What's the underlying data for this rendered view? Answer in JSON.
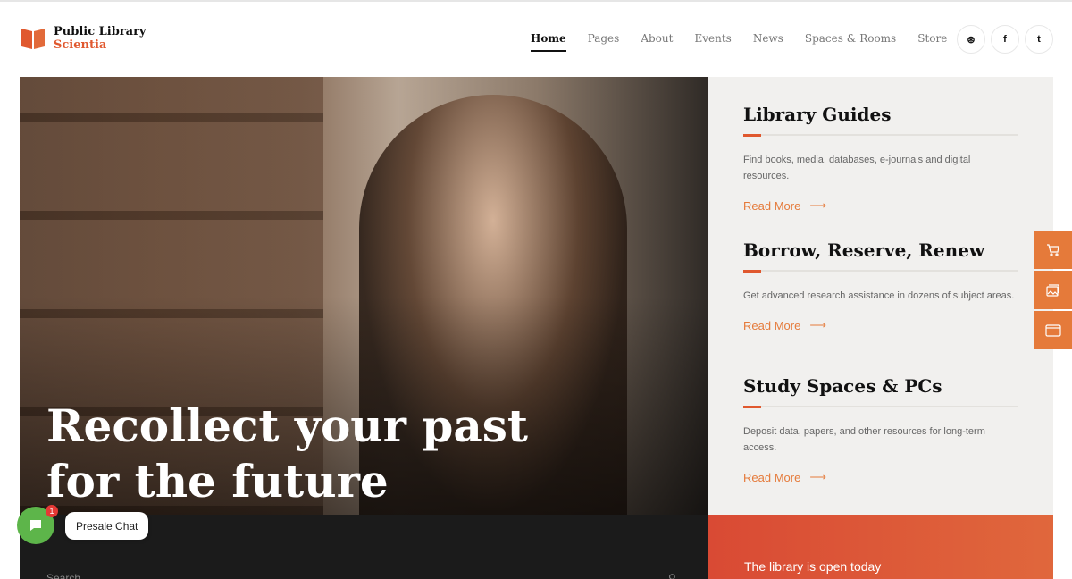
{
  "brand": {
    "line1": "Public Library",
    "line2": "Scientia",
    "accent": "#e0582e"
  },
  "nav": {
    "items": [
      {
        "label": "Home",
        "active": true
      },
      {
        "label": "Pages"
      },
      {
        "label": "About"
      },
      {
        "label": "Events"
      },
      {
        "label": "News"
      },
      {
        "label": "Spaces & Rooms"
      },
      {
        "label": "Store"
      }
    ]
  },
  "social": {
    "dribbble": "⊛",
    "facebook": "f",
    "twitter": "t"
  },
  "hero": {
    "title_line1": "Recollect your past",
    "title_line2": "for the future"
  },
  "cards": [
    {
      "title": "Library Guides",
      "text": "Find books, media, databases, e-journals and digital resources.",
      "link": "Read More"
    },
    {
      "title": "Borrow, Reserve, Renew",
      "text": "Get advanced research assistance in dozens of subject areas.",
      "link": "Read More"
    },
    {
      "title": "Study Spaces & PCs",
      "text": "Deposit data, papers, and other resources for long-term access.",
      "link": "Read More"
    }
  ],
  "search": {
    "label": "Search",
    "icon": "search-icon"
  },
  "status": {
    "open_text": "The library is open today"
  },
  "chat": {
    "label": "Presale Chat",
    "badge": "1"
  },
  "arrow": "⟶"
}
